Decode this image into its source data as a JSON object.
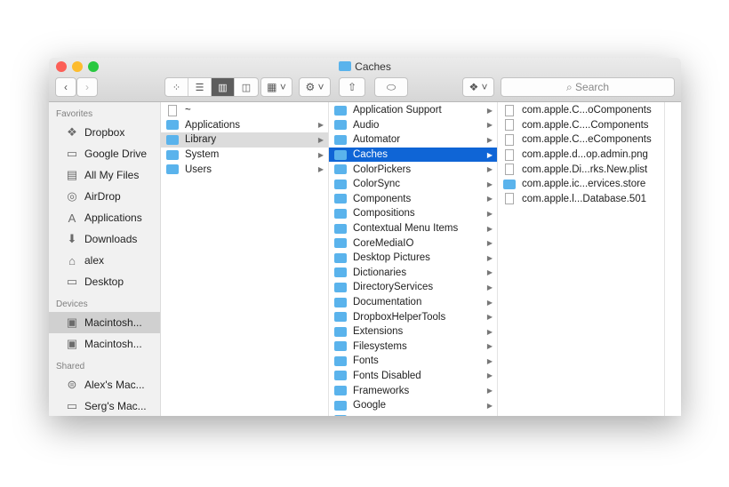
{
  "window": {
    "title": "Caches"
  },
  "toolbar": {
    "back": "‹",
    "forward": "›",
    "search_placeholder": "Search",
    "view_icons": [
      "icon-view",
      "list-view",
      "column-view",
      "coverflow-view"
    ]
  },
  "sidebar": {
    "favorites_header": "Favorites",
    "favorites": [
      {
        "label": "Dropbox",
        "icon": "❖"
      },
      {
        "label": "Google Drive",
        "icon": "▭"
      },
      {
        "label": "All My Files",
        "icon": "▤"
      },
      {
        "label": "AirDrop",
        "icon": "◎"
      },
      {
        "label": "Applications",
        "icon": "A"
      },
      {
        "label": "Downloads",
        "icon": "⬇"
      },
      {
        "label": "alex",
        "icon": "⌂"
      },
      {
        "label": "Desktop",
        "icon": "▭"
      }
    ],
    "devices_header": "Devices",
    "devices": [
      {
        "label": "Macintosh...",
        "icon": "▣"
      },
      {
        "label": "Macintosh...",
        "icon": "▣"
      }
    ],
    "shared_header": "Shared",
    "shared": [
      {
        "label": "Alex's Mac...",
        "icon": "⊜"
      },
      {
        "label": "Serg's Mac...",
        "icon": "▭"
      }
    ]
  },
  "columns": {
    "root": [
      "~",
      "Applications",
      "Library",
      "System",
      "Users"
    ],
    "library": [
      "Application Support",
      "Audio",
      "Automator",
      "Caches",
      "ColorPickers",
      "ColorSync",
      "Components",
      "Compositions",
      "Contextual Menu Items",
      "CoreMediaIO",
      "Desktop Pictures",
      "Dictionaries",
      "DirectoryServices",
      "Documentation",
      "DropboxHelperTools",
      "Extensions",
      "Filesystems",
      "Fonts",
      "Fonts Disabled",
      "Frameworks",
      "Google",
      ""
    ],
    "caches": [
      "com.apple.C...oComponents",
      "com.apple.C....Components",
      "com.apple.C...eComponents",
      "com.apple.d...op.admin.png",
      "com.apple.Di...rks.New.plist",
      "com.apple.ic...ervices.store",
      "com.apple.l...Database.501"
    ]
  },
  "colors": {
    "selection": "#0f65d6",
    "folder": "#5ab3ec"
  }
}
